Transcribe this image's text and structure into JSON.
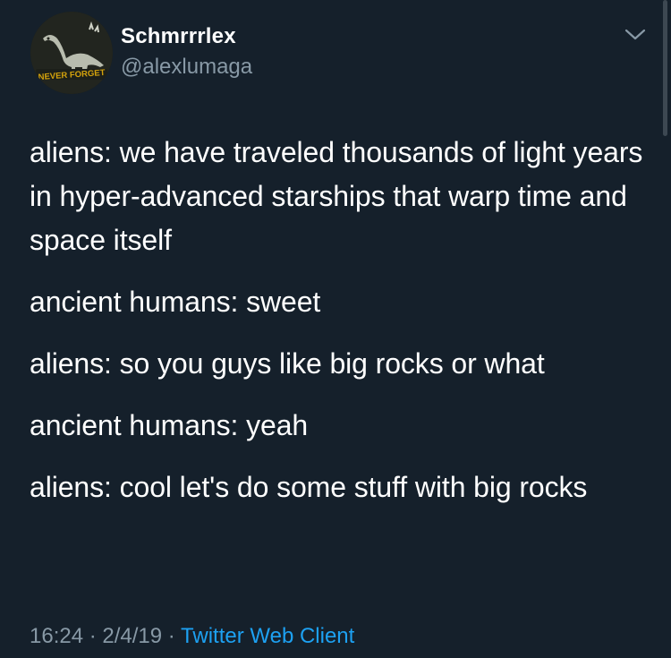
{
  "user": {
    "display_name": "Schmrrrlex",
    "handle": "@alexlumaga",
    "avatar_badge_text": "NEVER FORGET"
  },
  "tweet": {
    "lines": [
      "aliens: we have traveled thousands of light years in hyper-advanced starships that warp time and space itself",
      "ancient humans: sweet",
      "aliens: so you guys like big rocks or what",
      "ancient humans: yeah",
      "aliens: cool let's do some stuff with big rocks"
    ],
    "time": "16:24",
    "separator": " · ",
    "date": "2/4/19",
    "source": "Twitter Web Client"
  },
  "icons": {
    "menu": "chevron-down-icon",
    "avatar": "brontosaurus-icon"
  },
  "colors": {
    "background": "#15202b",
    "text": "#ffffff",
    "secondary_text": "#8899a6",
    "link": "#1da1f2",
    "avatar_badge": "#d4a20c"
  }
}
